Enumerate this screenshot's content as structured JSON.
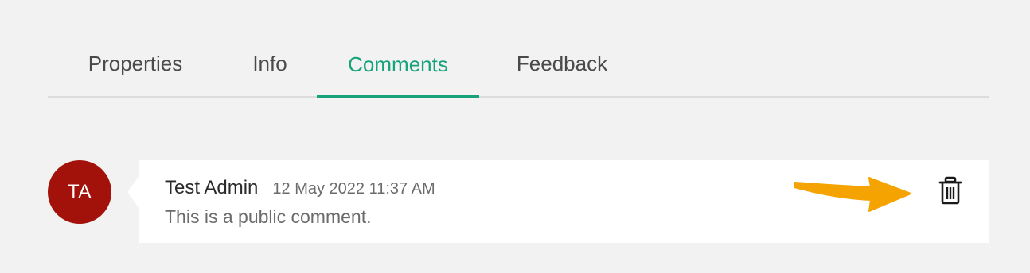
{
  "tabs": [
    {
      "label": "Properties",
      "active": false
    },
    {
      "label": "Info",
      "active": false
    },
    {
      "label": "Comments",
      "active": true
    },
    {
      "label": "Feedback",
      "active": false
    }
  ],
  "comment": {
    "avatar_initials": "TA",
    "author": "Test Admin",
    "timestamp": "12 May 2022 11:37 AM",
    "text": "This is a public comment.",
    "delete_icon": "trash-icon"
  },
  "colors": {
    "accent": "#16a37a",
    "avatar": "#a3120a",
    "annotation_arrow": "#f5a300"
  }
}
